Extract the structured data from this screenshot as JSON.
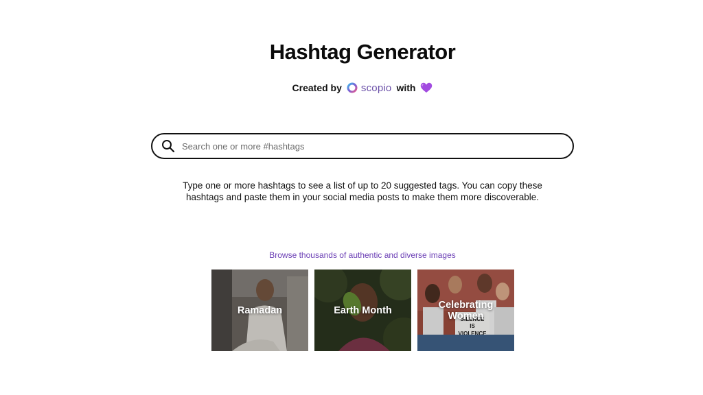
{
  "header": {
    "title": "Hashtag Generator",
    "credit_prefix": "Created by",
    "brand_name": "scopio",
    "credit_suffix": "with",
    "heart_icon": "purple-heart-icon"
  },
  "search": {
    "placeholder": "Search one or more #hashtags",
    "value": "",
    "icon": "search-icon"
  },
  "description": "Type one or more hashtags to see a list of up to 20 suggested tags. You can copy these hashtags and paste them in your social media posts to make them more discoverable.",
  "browse": {
    "link_text": "Browse thousands of authentic and diverse images",
    "cards": [
      {
        "label": "Ramadan"
      },
      {
        "label": "Earth Month"
      },
      {
        "label": "Celebrating\nWomen",
        "sign_text": "SILENCE IS VIOLENCE"
      }
    ]
  },
  "colors": {
    "link": "#6b3fb5",
    "brand": "#6a4fa8",
    "heart": "#a24be0",
    "border": "#111111"
  }
}
